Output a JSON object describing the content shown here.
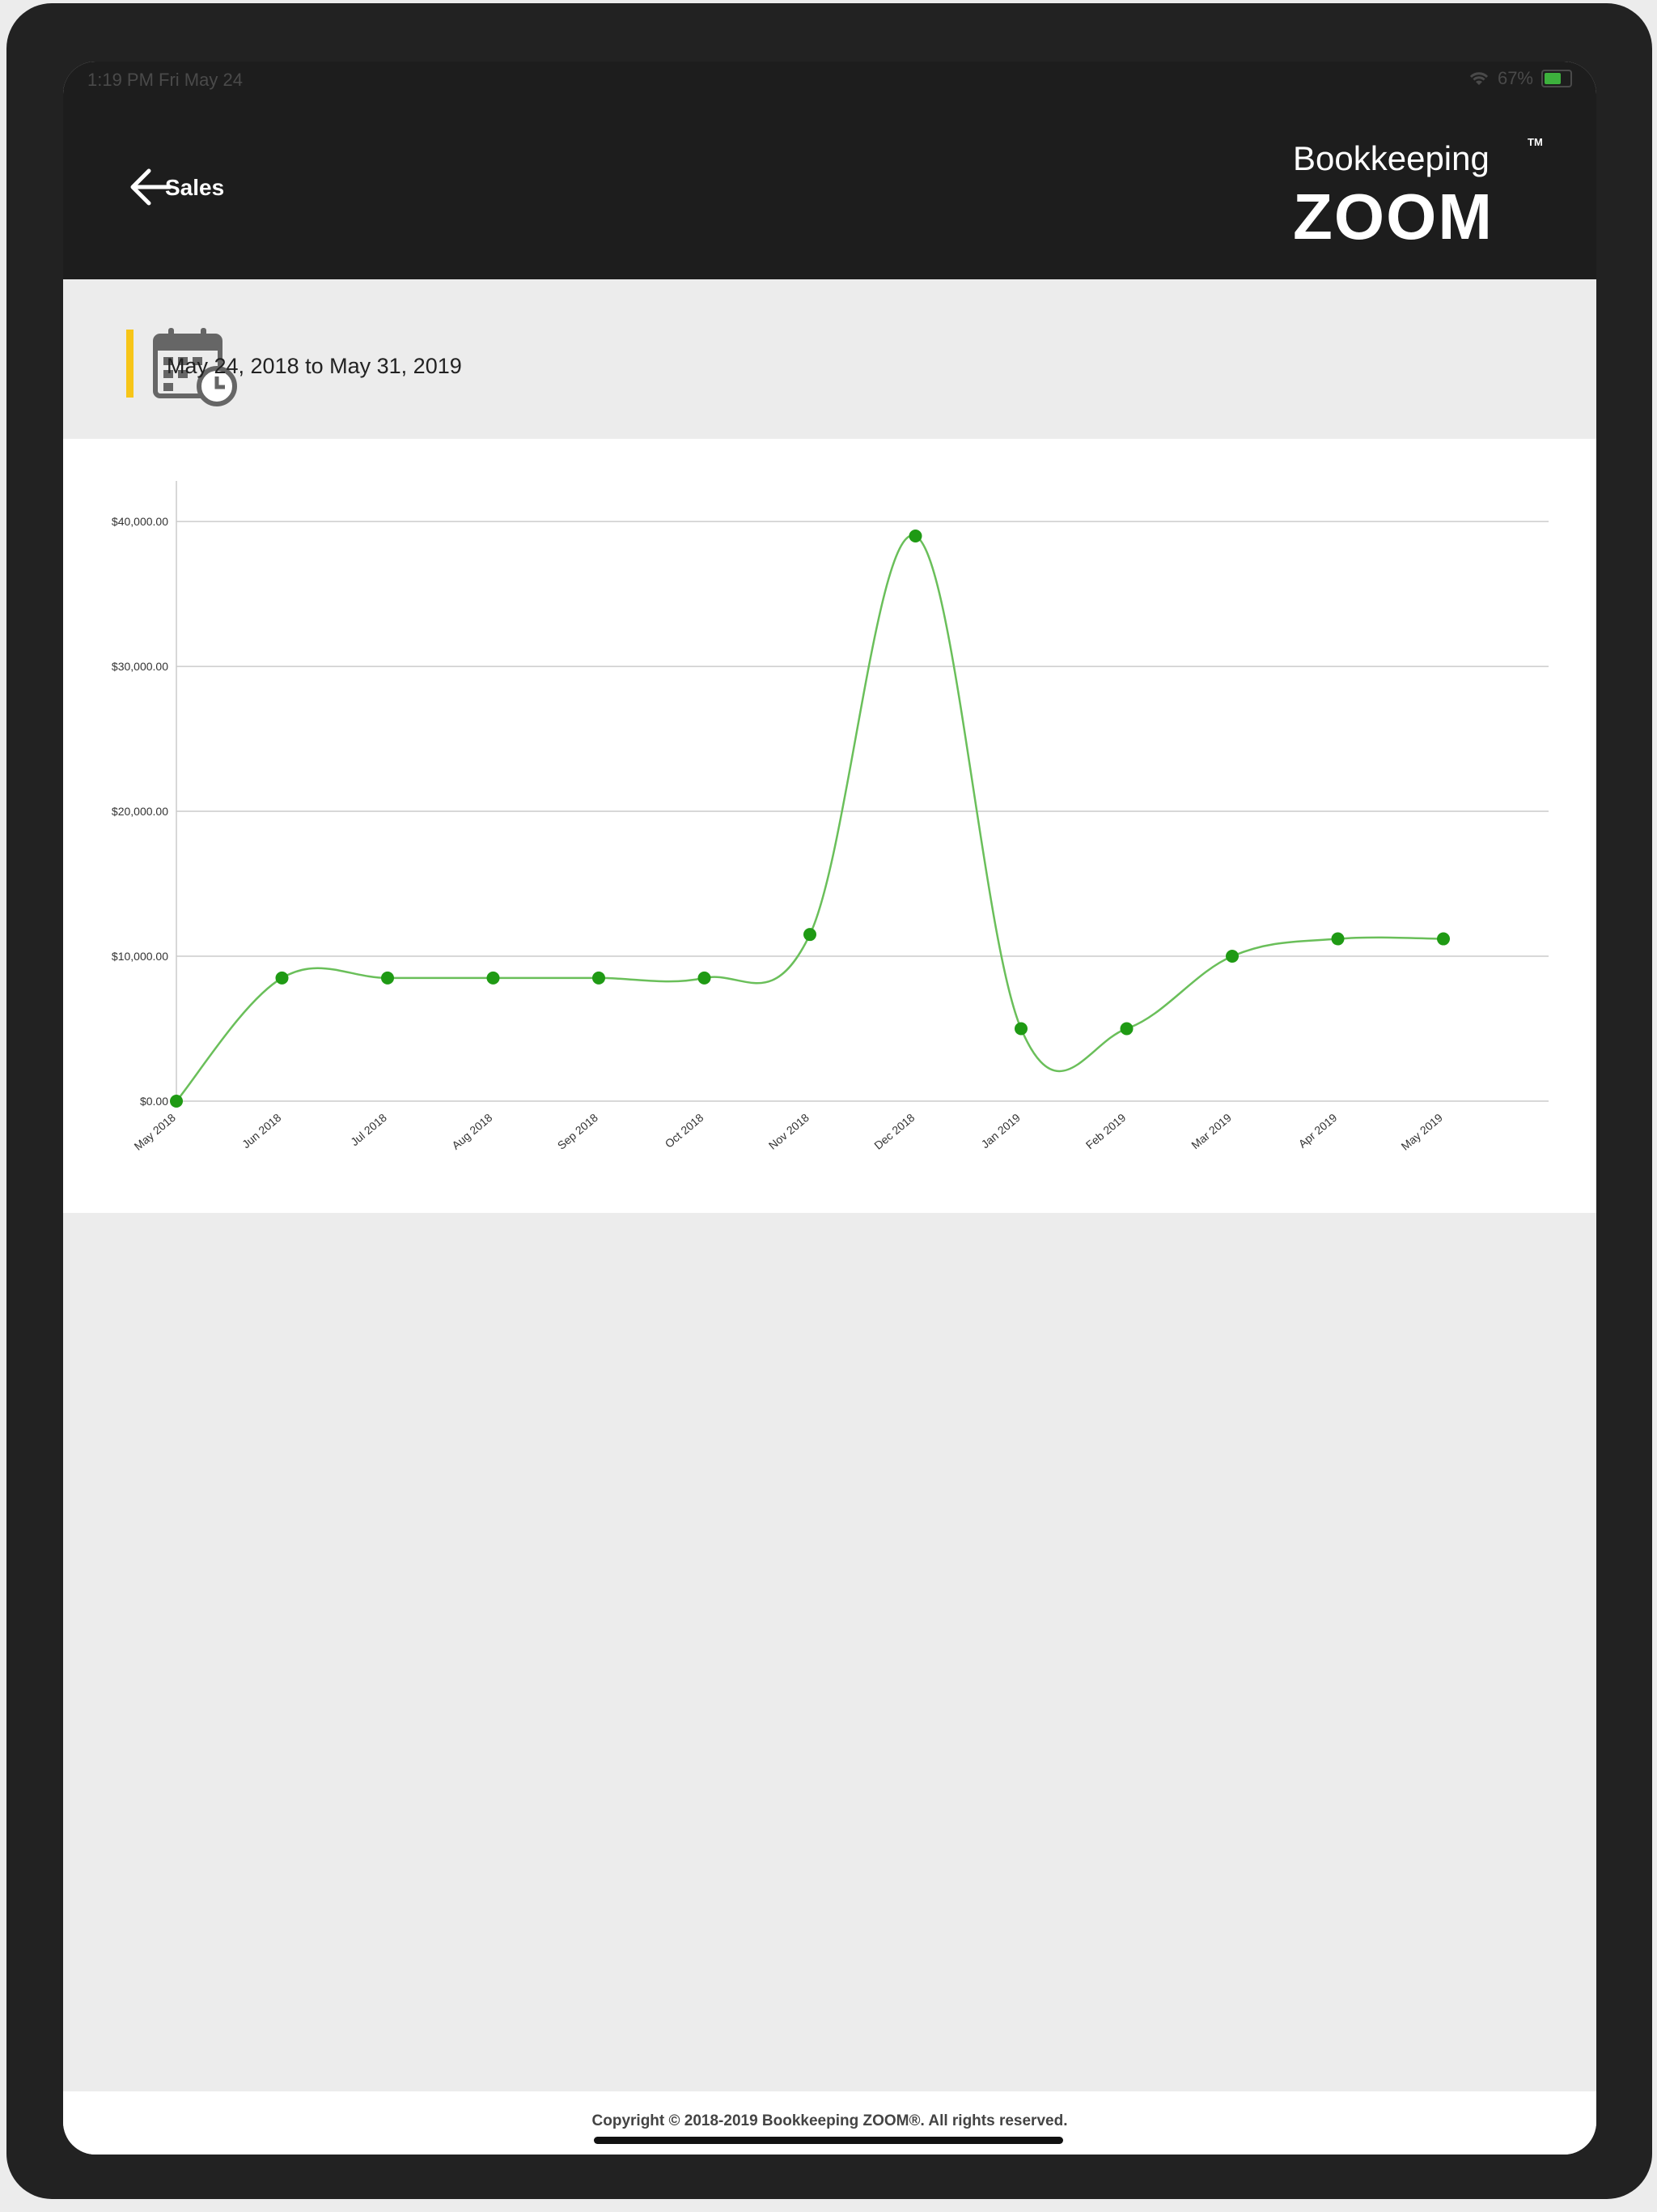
{
  "status_bar": {
    "time": "1:19 PM   Fri May 24",
    "battery": "67%"
  },
  "header": {
    "back_label": "Sales",
    "logo_top": "Bookkeeping",
    "logo_tm": "TM",
    "logo_bottom": "ZOOM"
  },
  "date_range": {
    "text": "May 24, 2018 to May 31, 2019"
  },
  "colors": {
    "accent": "#f7c518",
    "line": "#6abf5a",
    "point": "#1f9a14",
    "header_bg": "#1d1d1d"
  },
  "chart_data": {
    "type": "line",
    "categories": [
      "May 2018",
      "Jun 2018",
      "Jul 2018",
      "Aug 2018",
      "Sep 2018",
      "Oct 2018",
      "Nov 2018",
      "Dec 2018",
      "Jan 2019",
      "Feb 2019",
      "Mar 2019",
      "Apr 2019",
      "May 2019"
    ],
    "values": [
      0,
      8500,
      8500,
      8500,
      8500,
      8500,
      11500,
      39000,
      5000,
      5000,
      10000,
      11200,
      11200
    ],
    "y_ticks": [
      "$0.00",
      "$10,000.00",
      "$20,000.00",
      "$30,000.00",
      "$40,000.00"
    ],
    "y_tick_values": [
      0,
      10000,
      20000,
      30000,
      40000
    ],
    "ylim": [
      0,
      42800
    ],
    "grid": true
  },
  "footer": {
    "copyright": "Copyright © 2018-2019 Bookkeeping ZOOM®. All rights reserved."
  }
}
